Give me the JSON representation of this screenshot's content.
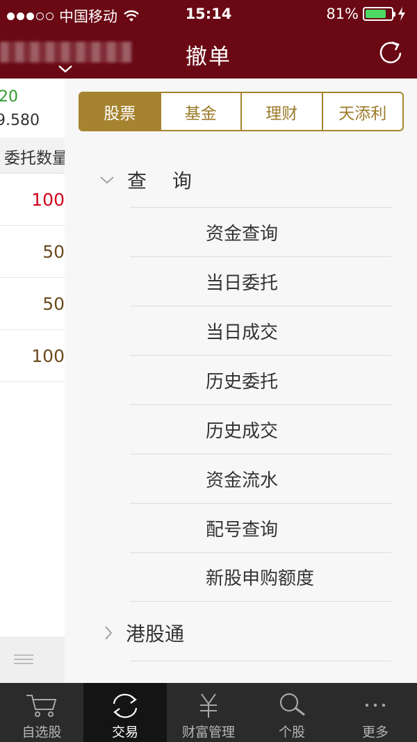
{
  "status_bar": {
    "carrier": "中国移动",
    "time": "15:14",
    "battery": "81%",
    "battery_level": 0.81
  },
  "nav": {
    "title": "撤单",
    "account_masked": "",
    "refresh_icon": "refresh-icon"
  },
  "background_list": {
    "change": "20",
    "price": "9.580",
    "column_header": "委托数量",
    "rows": [
      {
        "value": "100",
        "color": "#d0021b"
      },
      {
        "value": "50",
        "color": "#6b4a1e"
      },
      {
        "value": "50",
        "color": "#6b4a1e"
      },
      {
        "value": "100",
        "color": "#6b4a1e"
      }
    ]
  },
  "segments": {
    "items": [
      "股票",
      "基金",
      "理财",
      "天添利"
    ],
    "active_index": 0
  },
  "query_group": {
    "label": "查 询",
    "expanded": true,
    "items": [
      "资金查询",
      "当日委托",
      "当日成交",
      "历史委托",
      "历史成交",
      "资金流水",
      "配号查询",
      "新股申购额度"
    ]
  },
  "hk_group": {
    "label": "港股通",
    "expanded": false
  },
  "tabbar": {
    "items": [
      {
        "label": "自选股",
        "icon": "cart-icon",
        "active": false
      },
      {
        "label": "交易",
        "icon": "exchange-icon",
        "active": true
      },
      {
        "label": "财富管理",
        "icon": "yen-icon",
        "active": false
      },
      {
        "label": "个股",
        "icon": "search-icon",
        "active": false
      },
      {
        "label": "更多",
        "icon": "more-icon",
        "active": false
      }
    ]
  },
  "colors": {
    "header_bg": "#6a0814",
    "accent_gold": "#a5832f",
    "tabbar_bg": "#2b2b2b"
  }
}
